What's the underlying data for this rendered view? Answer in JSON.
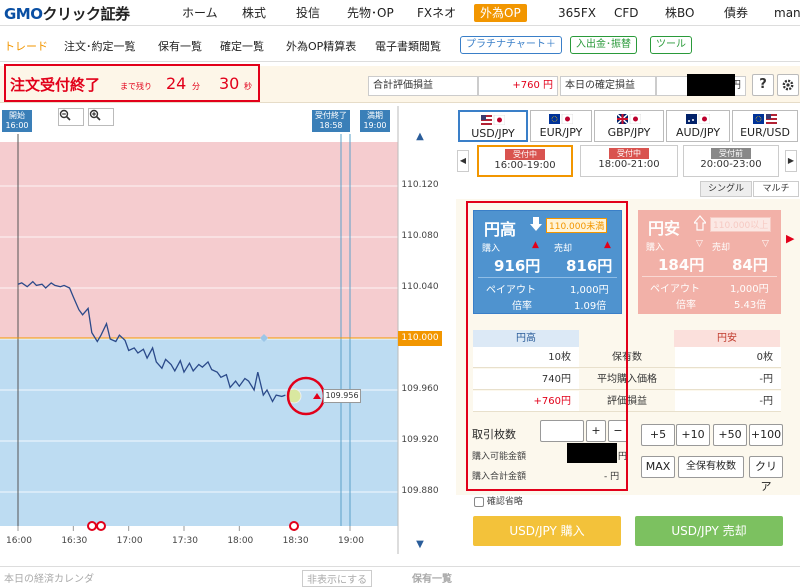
{
  "brand": {
    "logo_gmo": "GMO",
    "logo_rest": "クリック証券"
  },
  "topnav": {
    "items": [
      "ホーム",
      "株式",
      "投信",
      "先物･OP",
      "FXネオ",
      "外為OP",
      "365FX",
      "CFD",
      "株BO",
      "債券",
      "mane"
    ]
  },
  "subnav": {
    "items": [
      "トレード",
      "注文･約定一覧",
      "保有一覧",
      "確定一覧",
      "外為OP精算表",
      "電子書類閲覧"
    ],
    "buttons": [
      "プラチナチャート＋",
      "入出金･振替",
      "ツール"
    ]
  },
  "status": {
    "title": "注文受付終了",
    "remaining_label": "まで残り",
    "minutes": "24",
    "minutes_unit": "分",
    "seconds": "30",
    "seconds_unit": "秒",
    "total_pl_label": "合計評価損益",
    "total_pl_value": "+760 円",
    "realized_label": "本日の確定損益",
    "realized_unit": "円",
    "help": "?",
    "settings_icon": "gear-icon"
  },
  "chart": {
    "zoom_out": "−",
    "zoom_in": "+",
    "start_tag_title": "開始",
    "start_tag_time": "16:00",
    "end_tag_title": "受付終了",
    "end_tag_time": "18:58",
    "expiry_tag_title": "満期",
    "expiry_tag_time": "19:00",
    "current_price": "109.956",
    "target_price": "110.000",
    "colors": {
      "upper_zone": "#f5cccf",
      "lower_zone": "#bddcf2",
      "line": "#2b4a8a",
      "target": "#f29600"
    }
  },
  "chart_data": {
    "type": "line",
    "x_ticks": [
      "16:00",
      "16:30",
      "17:00",
      "17:30",
      "18:00",
      "18:30",
      "19:00"
    ],
    "y_ticks": [
      "110.120",
      "110.080",
      "110.040",
      "110.000",
      "109.960",
      "109.920",
      "109.880"
    ],
    "ylim": [
      109.86,
      110.14
    ],
    "series": [
      {
        "x": [
          "16:00",
          "16:02",
          "16:05",
          "16:08",
          "16:10",
          "16:13",
          "16:15",
          "16:18",
          "16:20",
          "16:23",
          "16:25",
          "16:28",
          "16:30",
          "16:33",
          "16:35",
          "16:38",
          "16:40",
          "16:43",
          "16:45",
          "16:48",
          "16:50",
          "16:53",
          "16:55",
          "16:58",
          "17:00",
          "17:03",
          "17:05",
          "17:08",
          "17:10",
          "17:13",
          "17:15",
          "17:18",
          "17:20",
          "17:23",
          "17:25",
          "17:28",
          "17:30",
          "17:33",
          "17:35",
          "17:38",
          "17:40",
          "17:43",
          "17:45",
          "17:48",
          "17:50",
          "17:53",
          "17:55",
          "17:58",
          "18:00",
          "18:03",
          "18:05",
          "18:08",
          "18:10",
          "18:13",
          "18:15",
          "18:18",
          "18:20",
          "18:23",
          "18:25"
        ],
        "values": [
          110.043,
          110.044,
          110.041,
          110.045,
          110.042,
          110.043,
          110.04,
          110.044,
          110.042,
          110.041,
          110.042,
          110.04,
          110.033,
          110.023,
          110.019,
          110.024,
          110.005,
          109.998,
          110.003,
          110.012,
          110.0,
          109.998,
          110.003,
          109.999,
          109.991,
          109.993,
          109.989,
          109.992,
          109.985,
          109.993,
          109.982,
          109.977,
          109.984,
          109.98,
          109.975,
          109.983,
          109.974,
          109.981,
          109.975,
          109.98,
          109.978,
          109.982,
          109.976,
          109.974,
          109.97,
          109.972,
          109.962,
          109.967,
          109.963,
          109.969,
          109.967,
          109.96,
          109.974,
          109.956,
          109.96,
          109.951,
          109.956,
          109.955,
          109.956
        ]
      }
    ]
  },
  "currencies": [
    {
      "pair": "USD/JPY",
      "flag": "us-jp-flag-icon"
    },
    {
      "pair": "EUR/JPY",
      "flag": "eu-jp-flag-icon"
    },
    {
      "pair": "GBP/JPY",
      "flag": "gb-jp-flag-icon"
    },
    {
      "pair": "AUD/JPY",
      "flag": "au-jp-flag-icon"
    },
    {
      "pair": "EUR/USD",
      "flag": "eu-us-flag-icon"
    }
  ],
  "sessions": [
    {
      "status": "受付中",
      "time": "16:00-19:00"
    },
    {
      "status": "受付中",
      "time": "18:00-21:00"
    },
    {
      "status": "受付前",
      "time": "20:00-23:00"
    }
  ],
  "mode": {
    "single": "シングル",
    "multi": "マルチ"
  },
  "high": {
    "title": "円高",
    "condition": "110.000未満",
    "buy_label": "購入",
    "sell_label": "売却",
    "buy_price": "916円",
    "sell_price": "816円",
    "payout_label": "ペイアウト",
    "payout_value": "1,000円",
    "rate_label": "倍率",
    "rate_value": "1.09倍"
  },
  "low": {
    "title": "円安",
    "condition": "110.000以上",
    "buy_label": "購入",
    "sell_label": "売却",
    "buy_price": "184円",
    "sell_price": "84円",
    "payout_label": "ペイアウト",
    "payout_value": "1,000円",
    "rate_label": "倍率",
    "rate_value": "5.43倍"
  },
  "positions": {
    "high_header": "円高",
    "low_header": "円安",
    "rows": [
      {
        "label": "保有数",
        "high": "10枚",
        "low": "0枚"
      },
      {
        "label": "平均購入価格",
        "high": "740円",
        "low": "-円"
      },
      {
        "label": "評価損益",
        "high": "+760円",
        "low": "-円"
      }
    ]
  },
  "order": {
    "qty_label": "取引枚数",
    "plus": "+",
    "minus": "−",
    "buyable_label": "購入可能金額",
    "buyable_unit": "円",
    "total_label": "購入合計金額",
    "total_value": "- 円",
    "quick": [
      "+5",
      "+10",
      "+50",
      "+100"
    ],
    "max": "MAX",
    "all": "全保有枚数",
    "clear": "クリア",
    "confirm_skip": "確認省略",
    "buy_button": "USD/JPY 購入",
    "sell_button": "USD/JPY 売却"
  },
  "bottom": {
    "calendar": "本日の経済カレンダ",
    "display": "非表示にする",
    "holdings": "保有一覧"
  }
}
